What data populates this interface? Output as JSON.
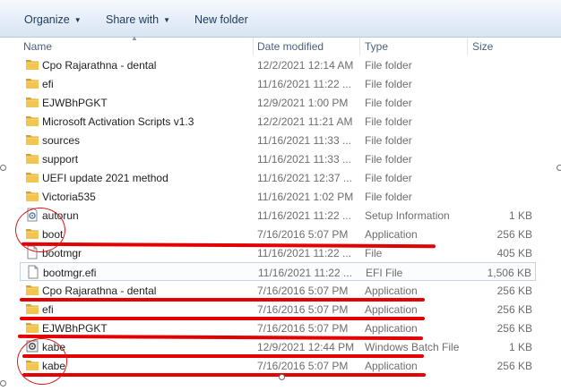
{
  "toolbar": {
    "organize_label": "Organize",
    "share_label": "Share with",
    "new_folder_label": "New folder"
  },
  "columns": {
    "name": "Name",
    "date": "Date modified",
    "type": "Type",
    "size": "Size"
  },
  "files": [
    {
      "name": "Cpo Rajarathna - dental",
      "date": "12/2/2021 12:14 AM",
      "type": "File folder",
      "size": "",
      "icon": "folder-icon"
    },
    {
      "name": "efi",
      "date": "11/16/2021 11:22 ...",
      "type": "File folder",
      "size": "",
      "icon": "folder-icon"
    },
    {
      "name": "EJWBhPGKT",
      "date": "12/9/2021 1:00 PM",
      "type": "File folder",
      "size": "",
      "icon": "folder-icon"
    },
    {
      "name": "Microsoft Activation Scripts v1.3",
      "date": "12/2/2021 11:21 AM",
      "type": "File folder",
      "size": "",
      "icon": "folder-icon"
    },
    {
      "name": "sources",
      "date": "11/16/2021 11:33 ...",
      "type": "File folder",
      "size": "",
      "icon": "folder-icon"
    },
    {
      "name": "support",
      "date": "11/16/2021 11:33 ...",
      "type": "File folder",
      "size": "",
      "icon": "folder-icon"
    },
    {
      "name": "UEFI update 2021 method",
      "date": "11/16/2021 12:37 ...",
      "type": "File folder",
      "size": "",
      "icon": "folder-icon"
    },
    {
      "name": "Victoria535",
      "date": "11/16/2021 1:02 PM",
      "type": "File folder",
      "size": "",
      "icon": "folder-icon"
    },
    {
      "name": "autorun",
      "date": "11/16/2021 11:22 ...",
      "type": "Setup Information",
      "size": "1 KB",
      "icon": "settings-file-icon"
    },
    {
      "name": "boot",
      "date": "7/16/2016 5:07 PM",
      "type": "Application",
      "size": "256 KB",
      "icon": "folder-icon"
    },
    {
      "name": "bootmgr",
      "date": "11/16/2021 11:22 ...",
      "type": "File",
      "size": "405 KB",
      "icon": "blank-file-icon"
    },
    {
      "name": "bootmgr.efi",
      "date": "11/16/2021 11:22 ...",
      "type": "EFI File",
      "size": "1,506 KB",
      "icon": "blank-file-icon"
    },
    {
      "name": "Cpo Rajarathna - dental",
      "date": "7/16/2016 5:07 PM",
      "type": "Application",
      "size": "256 KB",
      "icon": "folder-icon"
    },
    {
      "name": "efi",
      "date": "7/16/2016 5:07 PM",
      "type": "Application",
      "size": "256 KB",
      "icon": "folder-icon"
    },
    {
      "name": "EJWBhPGKT",
      "date": "7/16/2016 5:07 PM",
      "type": "Application",
      "size": "256 KB",
      "icon": "folder-icon"
    },
    {
      "name": "kabe",
      "date": "12/9/2021 12:44 PM",
      "type": "Windows Batch File",
      "size": "1 KB",
      "icon": "batch-file-icon"
    },
    {
      "name": "kabe",
      "date": "7/16/2016 5:07 PM",
      "type": "Application",
      "size": "256 KB",
      "icon": "folder-icon"
    }
  ]
}
